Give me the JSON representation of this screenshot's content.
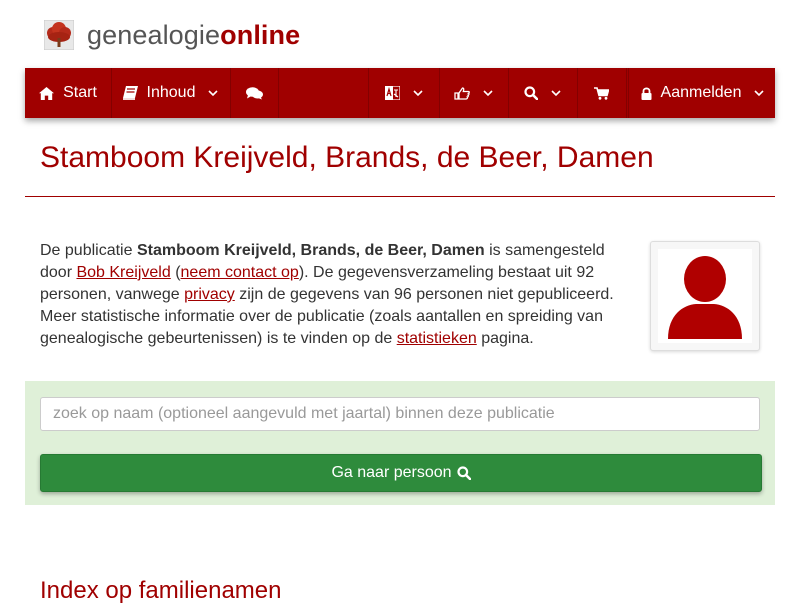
{
  "brand": {
    "name_part1": "genealogie",
    "name_part2": "online",
    "logo_icon": "tree-icon",
    "color_primary": "#a00000",
    "color_text": "#555555"
  },
  "navbar": {
    "background": "#a00000",
    "start_label": "Start",
    "start_icon": "home-icon",
    "inhoud_label": "Inhoud",
    "inhoud_icon": "book-icon",
    "comments_icon": "comments-icon",
    "language_icon": "language-icon",
    "share_icon": "thumbs-up-icon",
    "search_icon": "search-icon",
    "cart_icon": "shopping-cart-icon",
    "login_label": "Aanmelden",
    "login_icon": "lock-icon"
  },
  "page": {
    "title": "Stamboom Kreijveld, Brands, de Beer, Damen",
    "intro": {
      "t1": "De publicatie ",
      "pub_name": "Stamboom Kreijveld, Brands, de Beer, Damen",
      "t2": " is samengesteld door ",
      "author": "Bob Kreijveld",
      "t3": " (",
      "contact": "neem contact op",
      "t4": "). De gegevensverzameling bestaat uit 92 personen, vanwege ",
      "privacy": "privacy",
      "t5": " zijn de gegevens van 96 personen niet gepubliceerd. Meer statistische informatie over de publicatie (zoals aantallen en spreiding van genealogische gebeurtenissen) is te vinden op de ",
      "stats": "statistieken",
      "t6": " pagina."
    },
    "avatar_icon": "user-silhouette-icon"
  },
  "search": {
    "placeholder": "zoek op naam (optioneel aangevuld met jaartal) binnen deze publicatie",
    "value": "",
    "button_label": "Ga naar persoon",
    "button_icon": "search-icon",
    "well_color": "#dff0d8",
    "button_color": "#2e8b3c"
  },
  "section": {
    "heading": "Index op familienamen"
  }
}
